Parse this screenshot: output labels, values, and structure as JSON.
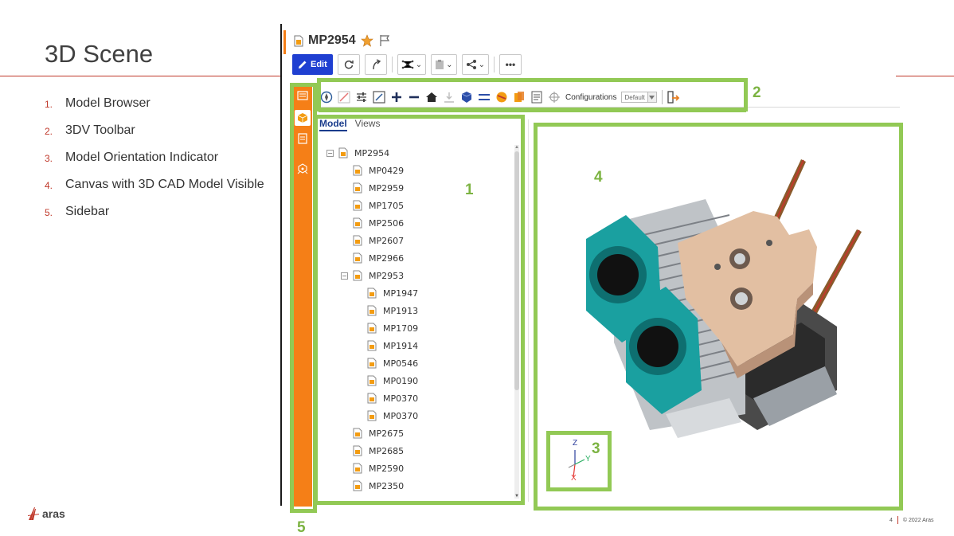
{
  "slide": {
    "title": "3D Scene",
    "bullets": [
      {
        "num": "1.",
        "text": "Model Browser"
      },
      {
        "num": "2.",
        "text": "3DV Toolbar"
      },
      {
        "num": "3.",
        "text": "Model Orientation Indicator"
      },
      {
        "num": "4.",
        "text": "Canvas with 3D CAD Model Visible"
      },
      {
        "num": "5.",
        "text": "Sidebar"
      }
    ],
    "logo": "aras",
    "page_number": "4",
    "copyright": "© 2022 Aras"
  },
  "header": {
    "item_name": "MP2954",
    "edit_label": "Edit",
    "more_label": "•••"
  },
  "toolbar_3dv": {
    "configurations_label": "Configurations",
    "configuration_value": "Default"
  },
  "browser": {
    "tab_model": "Model",
    "tab_views": "Views",
    "tree": [
      {
        "label": "MP2954",
        "level": 0,
        "expander": "−"
      },
      {
        "label": "MP0429",
        "level": 1
      },
      {
        "label": "MP2959",
        "level": 1
      },
      {
        "label": "MP1705",
        "level": 1
      },
      {
        "label": "MP2506",
        "level": 1
      },
      {
        "label": "MP2607",
        "level": 1
      },
      {
        "label": "MP2966",
        "level": 1
      },
      {
        "label": "MP2953",
        "level": 1,
        "expander": "−"
      },
      {
        "label": "MP1947",
        "level": 2
      },
      {
        "label": "MP1913",
        "level": 2
      },
      {
        "label": "MP1709",
        "level": 2
      },
      {
        "label": "MP1914",
        "level": 2
      },
      {
        "label": "MP0546",
        "level": 2
      },
      {
        "label": "MP0190",
        "level": 2
      },
      {
        "label": "MP0370",
        "level": 2
      },
      {
        "label": "MP0370",
        "level": 2
      },
      {
        "label": "MP2675",
        "level": 1
      },
      {
        "label": "MP2685",
        "level": 1
      },
      {
        "label": "MP2590",
        "level": 1
      },
      {
        "label": "MP2350",
        "level": 1
      }
    ]
  },
  "callouts": {
    "one": "1",
    "two": "2",
    "three": "3",
    "four": "4",
    "five": "5"
  },
  "orientation": {
    "z": "Z",
    "y": "Y",
    "x": "X"
  },
  "colors": {
    "accent_orange": "#f57f17",
    "callout_green": "#92c955",
    "edit_blue": "#1f3fd1",
    "title_rule_red": "#c0392b"
  }
}
